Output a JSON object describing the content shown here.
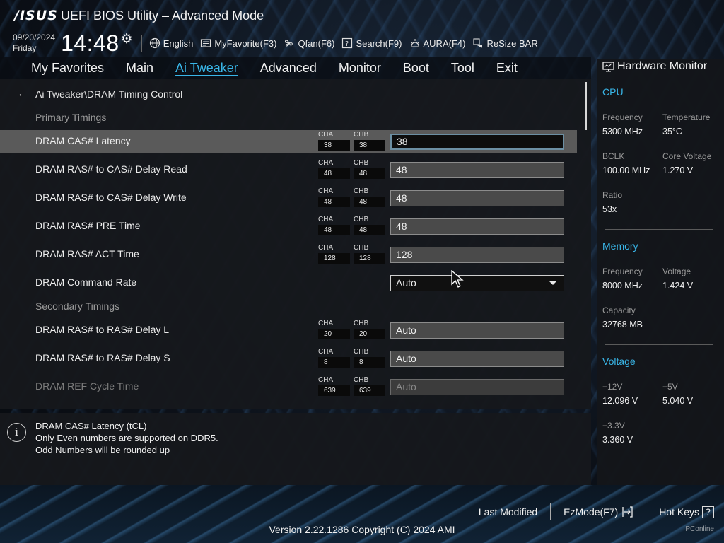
{
  "header": {
    "logo": "/ISUS",
    "title": "UEFI BIOS Utility – Advanced Mode",
    "date": "09/20/2024",
    "day": "Friday",
    "time": "14:48",
    "hotkeys": [
      {
        "label": "English",
        "icon": "globe-icon"
      },
      {
        "label": "MyFavorite(F3)",
        "icon": "favorite-icon"
      },
      {
        "label": "Qfan(F6)",
        "icon": "fan-icon"
      },
      {
        "label": "Search(F9)",
        "icon": "search-icon"
      },
      {
        "label": "AURA(F4)",
        "icon": "aura-icon"
      },
      {
        "label": "ReSize BAR",
        "icon": "resize-bar-icon"
      }
    ]
  },
  "nav": {
    "tabs": [
      "My Favorites",
      "Main",
      "Ai Tweaker",
      "Advanced",
      "Monitor",
      "Boot",
      "Tool",
      "Exit"
    ],
    "active": "Ai Tweaker"
  },
  "main": {
    "breadcrumb": "Ai Tweaker\\DRAM Timing Control",
    "primary_title": "Primary Timings",
    "secondary_title": "Secondary Timings",
    "cha_label": "CHA",
    "chb_label": "CHB",
    "rows": [
      {
        "label": "DRAM CAS# Latency",
        "cha": "38",
        "chb": "38",
        "value": "38"
      },
      {
        "label": "DRAM RAS# to CAS# Delay Read",
        "cha": "48",
        "chb": "48",
        "value": "48"
      },
      {
        "label": "DRAM RAS# to CAS# Delay Write",
        "cha": "48",
        "chb": "48",
        "value": "48"
      },
      {
        "label": "DRAM RAS# PRE Time",
        "cha": "48",
        "chb": "48",
        "value": "48"
      },
      {
        "label": "DRAM RAS# ACT Time",
        "cha": "128",
        "chb": "128",
        "value": "128"
      },
      {
        "label": "DRAM Command Rate",
        "value": "Auto"
      },
      {
        "label": "DRAM RAS# to RAS# Delay L",
        "cha": "20",
        "chb": "20",
        "value": "Auto"
      },
      {
        "label": "DRAM RAS# to RAS# Delay S",
        "cha": "8",
        "chb": "8",
        "value": "Auto"
      },
      {
        "label": "DRAM REF Cycle Time",
        "cha": "639",
        "chb": "639",
        "value": "Auto"
      }
    ]
  },
  "help": {
    "line1": "DRAM CAS# Latency (tCL)",
    "line2": "Only Even numbers are supported on DDR5.",
    "line3": "Odd Numbers will be rounded up"
  },
  "hardware_monitor": {
    "title": "Hardware Monitor",
    "cpu": {
      "title": "CPU",
      "frequency_label": "Frequency",
      "frequency": "5300 MHz",
      "temperature_label": "Temperature",
      "temperature": "35°C",
      "bclk_label": "BCLK",
      "bclk": "100.00 MHz",
      "core_voltage_label": "Core Voltage",
      "core_voltage": "1.270 V",
      "ratio_label": "Ratio",
      "ratio": "53x"
    },
    "memory": {
      "title": "Memory",
      "frequency_label": "Frequency",
      "frequency": "8000 MHz",
      "voltage_label": "Voltage",
      "voltage": "1.424 V",
      "capacity_label": "Capacity",
      "capacity": "32768 MB"
    },
    "voltage": {
      "title": "Voltage",
      "v12_label": "+12V",
      "v12": "12.096 V",
      "v5_label": "+5V",
      "v5": "5.040 V",
      "v33_label": "+3.3V",
      "v33": "3.360 V"
    }
  },
  "footer": {
    "last_modified": "Last Modified",
    "ezmode": "EzMode(F7)",
    "hotkeys": "Hot Keys",
    "hotkeys_key": "?",
    "version": "Version 2.22.1286 Copyright (C) 2024 AMI",
    "watermark": "PConline"
  },
  "colors": {
    "accent": "#39b6e8",
    "selected_row": "#5a5a5a",
    "panel": "#16181c"
  }
}
